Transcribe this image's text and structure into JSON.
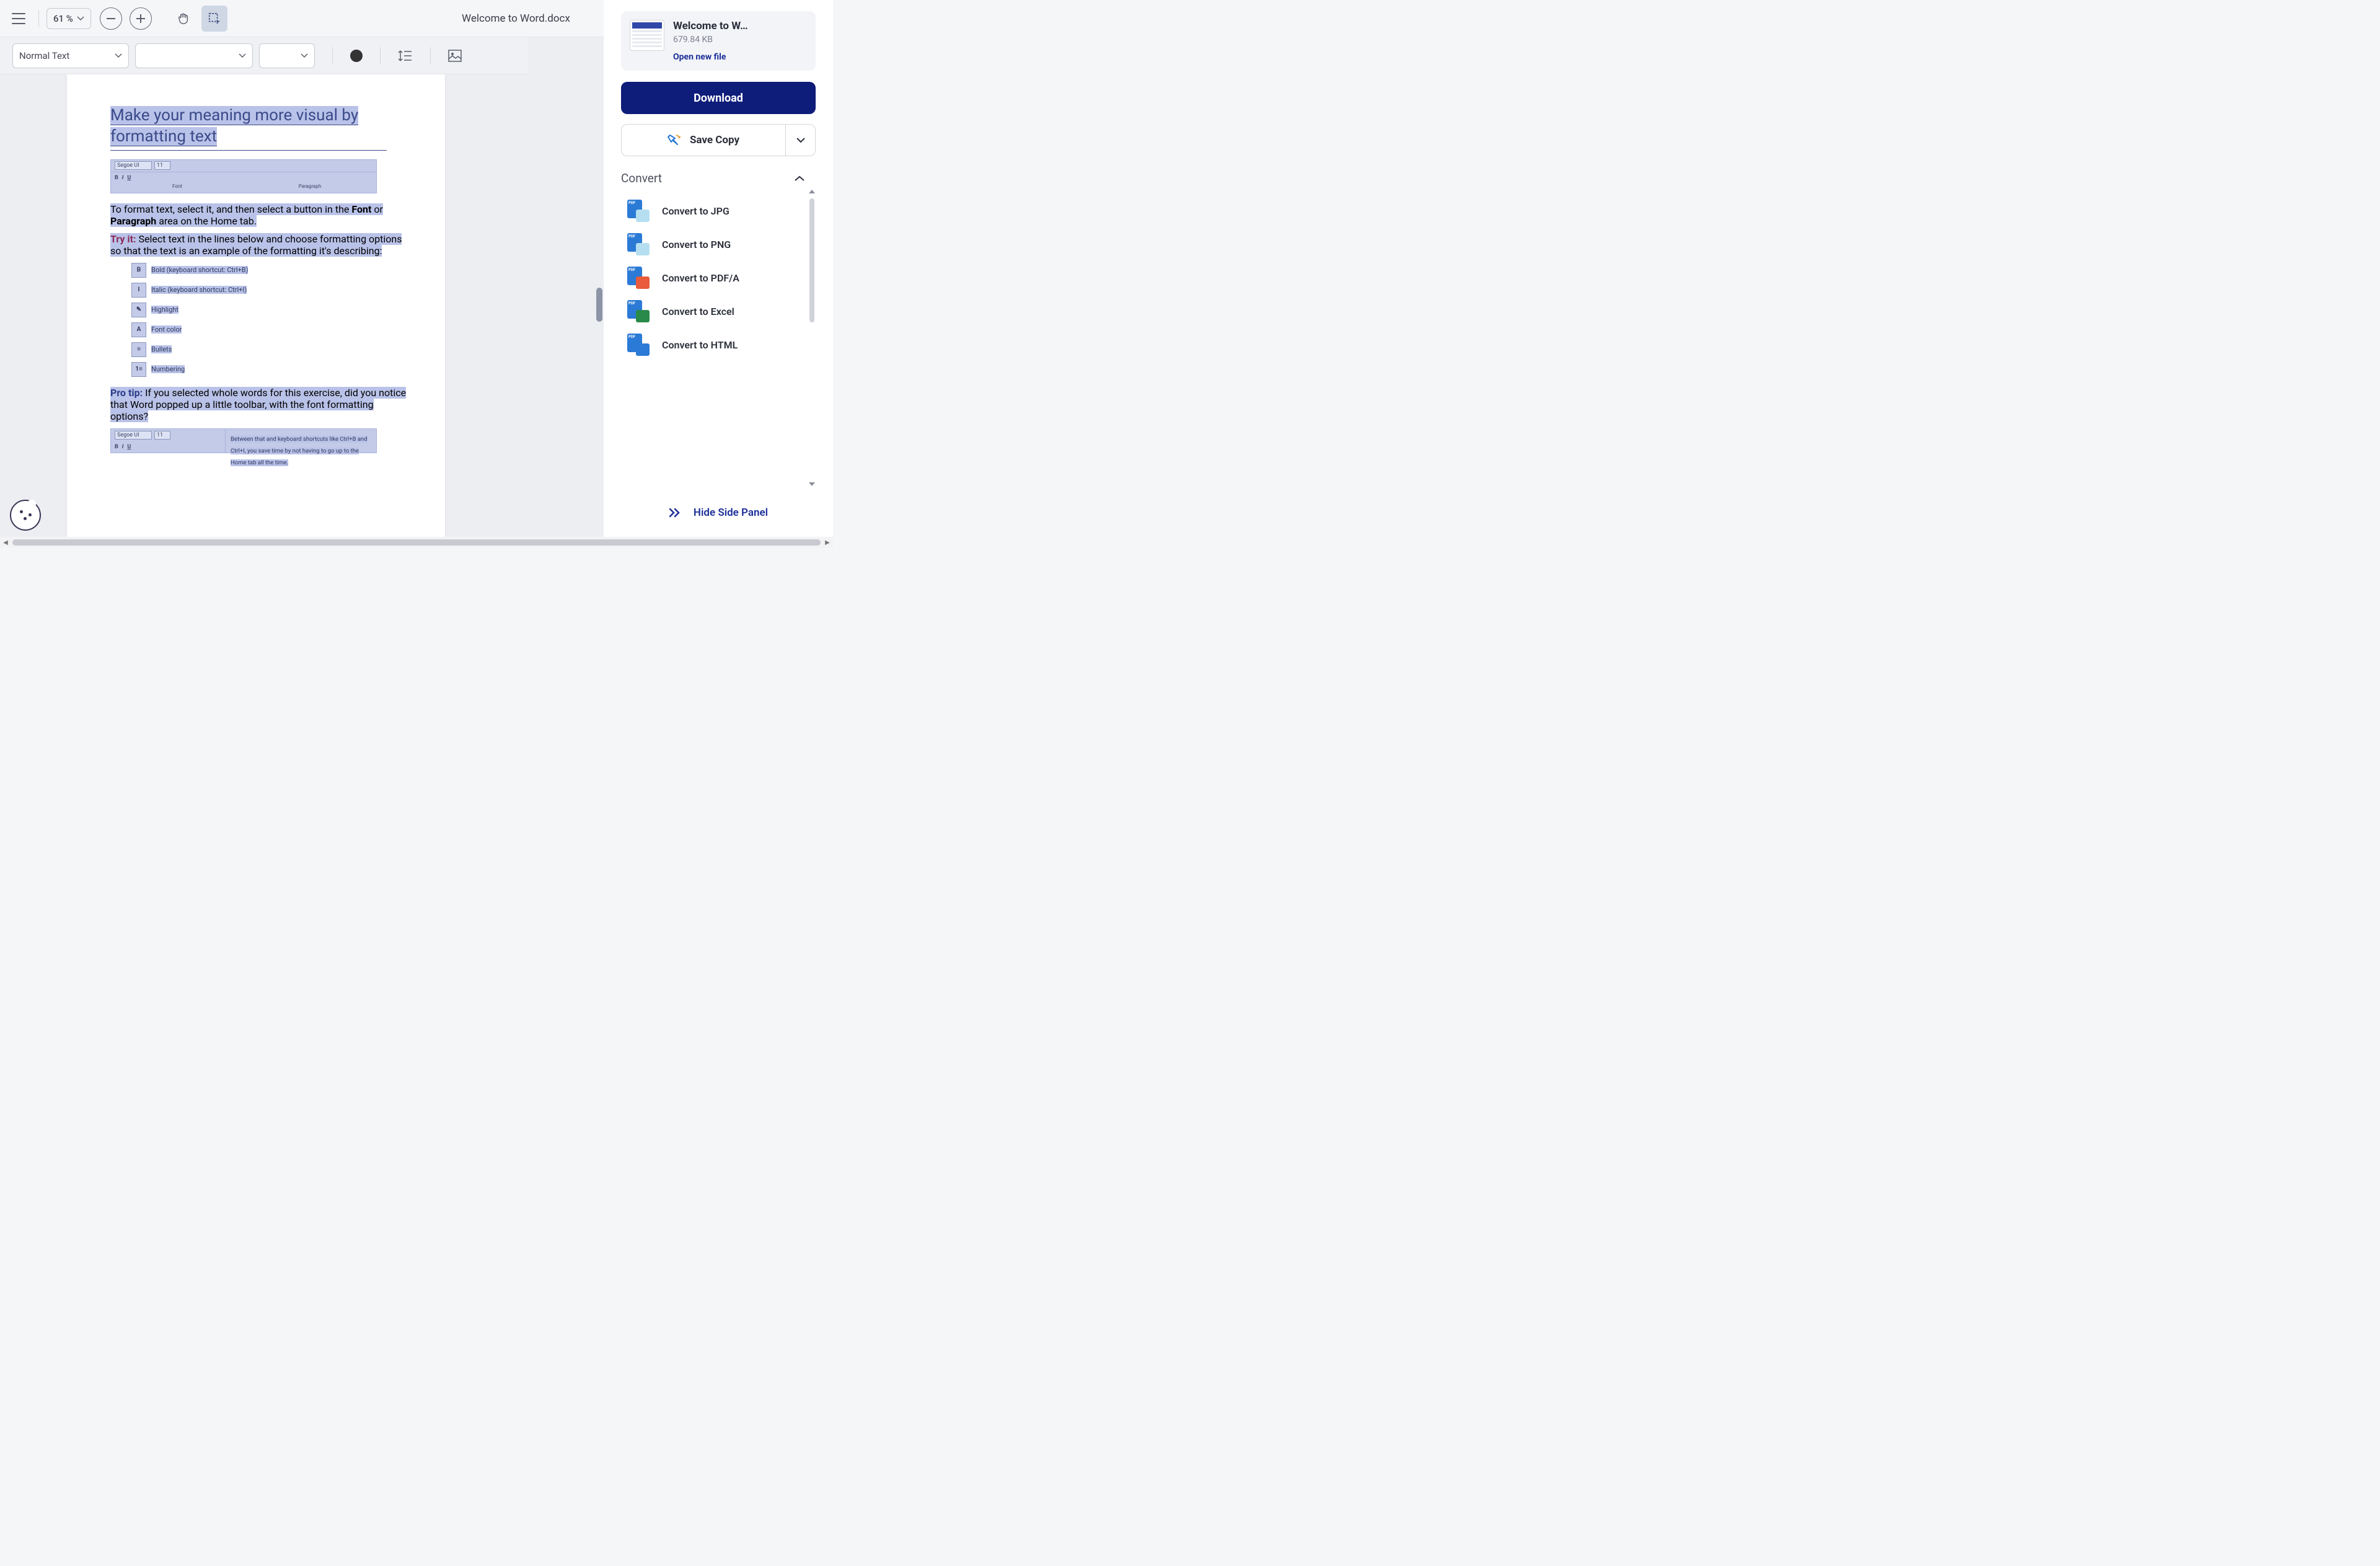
{
  "topbar": {
    "zoom": "61 %",
    "title": "Welcome to Word.docx"
  },
  "formatbar": {
    "style": "Normal Text",
    "font": "",
    "size": ""
  },
  "document": {
    "heading": "Make your meaning more visual by formatting text",
    "ribbon_font": "Segoe UI",
    "ribbon_size": "11",
    "ribbon_sec_font": "Font",
    "ribbon_sec_para": "Paragraph",
    "p1_a": "To format text, select it, and then select a button in the ",
    "p1_b": "Font",
    "p1_c": " or ",
    "p1_d": "Paragraph",
    "p1_e": " area on the Home tab.",
    "tryit": "Try it:",
    "p2": " Select text in the lines below and choose formatting options so that the text is an example of the formatting it's describing:",
    "items": [
      {
        "icon": "B",
        "label": "Bold (keyboard shortcut: Ctrl+B)"
      },
      {
        "icon": "I",
        "label": "Italic (keyboard shortcut: Ctrl+I)"
      },
      {
        "icon": "✎",
        "label": "Highlight"
      },
      {
        "icon": "A",
        "label": "Font color"
      },
      {
        "icon": "≡",
        "label": "Bullets"
      },
      {
        "icon": "1≡",
        "label": "Numbering"
      }
    ],
    "protip": "Pro tip:",
    "p3": " If you selected whole words for this exercise, did you notice that Word popped up a little toolbar, with the font formatting options?",
    "p4": "Between that and keyboard shortcuts like Ctrl+B and Ctrl+I, you save time by not having to go up to the Home tab all the time."
  },
  "sidepanel": {
    "filename": "Welcome to W…",
    "filesize": "679.84 KB",
    "open_link": "Open new file",
    "download": "Download",
    "savecopy": "Save Copy",
    "convert_header": "Convert",
    "convert_items": [
      {
        "label": "Convert to JPG",
        "cls": "jpg"
      },
      {
        "label": "Convert to PNG",
        "cls": "png"
      },
      {
        "label": "Convert to PDF/A",
        "cls": "pdfa"
      },
      {
        "label": "Convert to Excel",
        "cls": "excel"
      },
      {
        "label": "Convert to HTML",
        "cls": "html"
      }
    ],
    "hide": "Hide Side Panel"
  }
}
